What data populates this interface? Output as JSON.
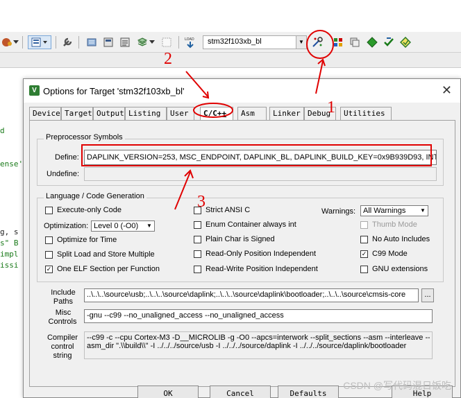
{
  "toolbar": {
    "target_select": "stm32f103xb_bl",
    "icons": [
      "options-icon",
      "dropdown-icon",
      "layout-icon",
      "wrench-icon",
      "build-icon",
      "rebuild-icon",
      "batch-icon",
      "stack-icon",
      "blank-icon",
      "load-icon",
      "target-options-icon",
      "manage-icon",
      "copy-icon",
      "diamond-icon",
      "check-icon",
      "pack-icon"
    ],
    "load_label": "LOAD"
  },
  "background_code": [
    "d",
    "ense'",
    "g, s",
    "s\" B",
    "impl",
    "issi"
  ],
  "dialog": {
    "title": "Options for Target 'stm32f103xb_bl'",
    "close": "✕",
    "tabs": [
      "Device",
      "Target",
      "Output",
      "Listing",
      "User",
      "C/C++",
      "Asm",
      "Linker",
      "Debug",
      "Utilities"
    ],
    "active_tab": "C/C++",
    "preprocessor": {
      "legend": "Preprocessor Symbols",
      "define_label": "Define:",
      "define_value": "DAPLINK_VERSION=253, MSC_ENDPOINT, DAPLINK_BL, DAPLINK_BUILD_KEY=0x9B939D93, INTI",
      "undefine_label": "Undefine:",
      "undefine_value": ""
    },
    "language": {
      "legend": "Language / Code Generation",
      "execute_only": {
        "label": "Execute-only Code",
        "checked": false
      },
      "optimization_label": "Optimization:",
      "optimization_value": "Level 0 (-O0)",
      "optimize_time": {
        "label": "Optimize for Time",
        "checked": false
      },
      "split_load": {
        "label": "Split Load and Store Multiple",
        "checked": false
      },
      "one_elf": {
        "label": "One ELF Section per Function",
        "checked": true
      },
      "strict_ansi": {
        "label": "Strict ANSI C",
        "checked": false
      },
      "enum_container": {
        "label": "Enum Container always int",
        "checked": false
      },
      "plain_char": {
        "label": "Plain Char is Signed",
        "checked": false
      },
      "ro_pi": {
        "label": "Read-Only Position Independent",
        "checked": false
      },
      "rw_pi": {
        "label": "Read-Write Position Independent",
        "checked": false
      },
      "warnings_label": "Warnings:",
      "warnings_value": "All Warnings",
      "thumb_mode": {
        "label": "Thumb Mode",
        "checked": false
      },
      "no_auto_includes": {
        "label": "No Auto Includes",
        "checked": false
      },
      "c99_mode": {
        "label": "C99 Mode",
        "checked": true
      },
      "gnu_ext": {
        "label": "GNU extensions",
        "checked": false
      }
    },
    "include_paths_label_1": "Include",
    "include_paths_label_2": "Paths",
    "include_paths_value": "..\\..\\..\\source\\usb;..\\..\\..\\source\\daplink;..\\..\\..\\source\\daplink\\bootloader;..\\..\\..\\source\\cmsis-core",
    "browse": "...",
    "misc_label_1": "Misc",
    "misc_label_2": "Controls",
    "misc_value": "-gnu --c99 --no_unaligned_access --no_unaligned_access",
    "compiler_label_1": "Compiler",
    "compiler_label_2": "control",
    "compiler_label_3": "string",
    "compiler_line_1": "--c99 -c --cpu Cortex-M3 -D__MICROLIB -g -O0 --apcs=interwork --split_sections --asm --interleave --",
    "compiler_line_2": "asm_dir \".\\\\build\\\\\" -I ../../../source/usb -I ../../../source/daplink -I ../../../source/daplink/bootloader",
    "buttons": {
      "ok": "OK",
      "cancel": "Cancel",
      "defaults": "Defaults",
      "help": "Help"
    }
  },
  "annotations": {
    "n1": "1",
    "n2": "2",
    "n3": "3",
    "color": "#e00000"
  },
  "watermark": "CSDN @写代码混日饭吃"
}
